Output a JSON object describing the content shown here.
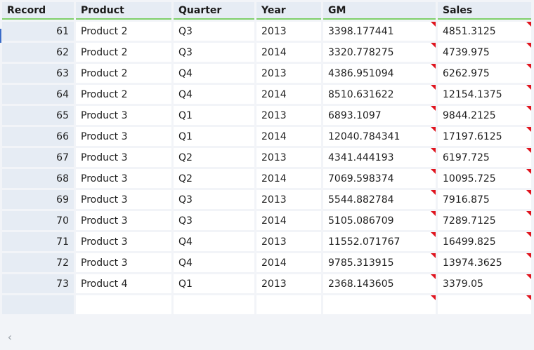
{
  "columns": [
    "Record",
    "Product",
    "Quarter",
    "Year",
    "GM",
    "Sales"
  ],
  "rows": [
    {
      "record": "61",
      "product": "Product 2",
      "quarter": "Q3",
      "year": "2013",
      "gm": "3398.177441",
      "sales": "4851.3125"
    },
    {
      "record": "62",
      "product": "Product 2",
      "quarter": "Q3",
      "year": "2014",
      "gm": "3320.778275",
      "sales": "4739.975"
    },
    {
      "record": "63",
      "product": "Product 2",
      "quarter": "Q4",
      "year": "2013",
      "gm": "4386.951094",
      "sales": "6262.975"
    },
    {
      "record": "64",
      "product": "Product 2",
      "quarter": "Q4",
      "year": "2014",
      "gm": "8510.631622",
      "sales": "12154.1375"
    },
    {
      "record": "65",
      "product": "Product 3",
      "quarter": "Q1",
      "year": "2013",
      "gm": "6893.1097",
      "sales": "9844.2125"
    },
    {
      "record": "66",
      "product": "Product 3",
      "quarter": "Q1",
      "year": "2014",
      "gm": "12040.784341",
      "sales": "17197.6125"
    },
    {
      "record": "67",
      "product": "Product 3",
      "quarter": "Q2",
      "year": "2013",
      "gm": "4341.444193",
      "sales": "6197.725"
    },
    {
      "record": "68",
      "product": "Product 3",
      "quarter": "Q2",
      "year": "2014",
      "gm": "7069.598374",
      "sales": "10095.725"
    },
    {
      "record": "69",
      "product": "Product 3",
      "quarter": "Q3",
      "year": "2013",
      "gm": "5544.882784",
      "sales": "7916.875"
    },
    {
      "record": "70",
      "product": "Product 3",
      "quarter": "Q3",
      "year": "2014",
      "gm": "5105.086709",
      "sales": "7289.7125"
    },
    {
      "record": "71",
      "product": "Product 3",
      "quarter": "Q4",
      "year": "2013",
      "gm": "11552.071767",
      "sales": "16499.825"
    },
    {
      "record": "72",
      "product": "Product 3",
      "quarter": "Q4",
      "year": "2014",
      "gm": "9785.313915",
      "sales": "13974.3625"
    },
    {
      "record": "73",
      "product": "Product 4",
      "quarter": "Q1",
      "year": "2013",
      "gm": "2368.143605",
      "sales": "3379.05"
    },
    {
      "record": "",
      "product": "",
      "quarter": "",
      "year": "",
      "gm": "",
      "sales": ""
    }
  ],
  "scrollbar": {
    "left_arrow_icon": "chevron-left-icon",
    "left_arrow_glyph": "‹"
  },
  "colors": {
    "header_underline": "#7fd06a",
    "flag": "#e0141e",
    "header_bg": "#e6ecf4",
    "grid_bg": "#f2f4f8"
  }
}
